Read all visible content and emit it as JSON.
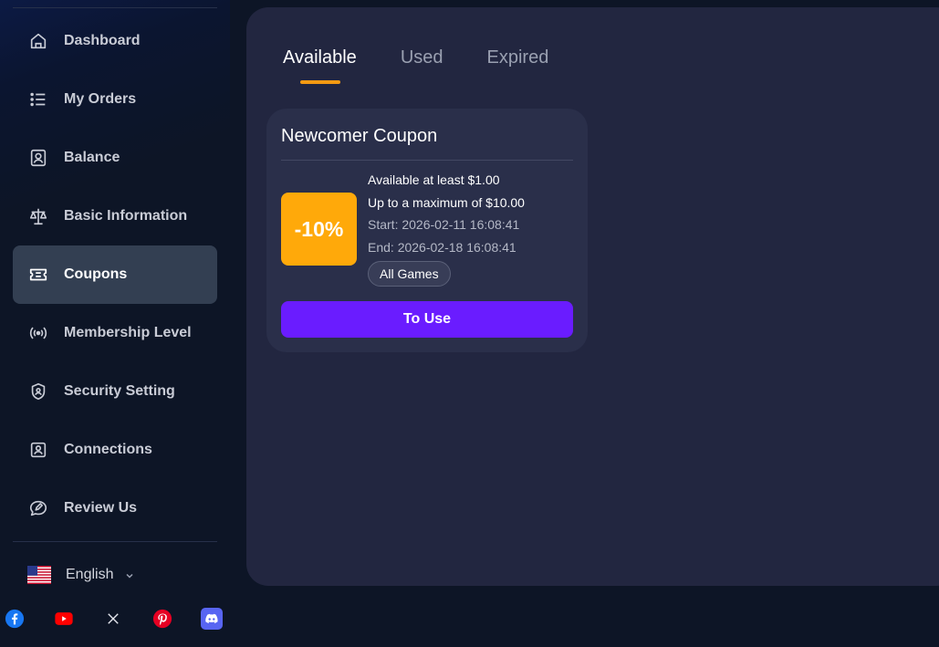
{
  "sidebar": {
    "items": [
      {
        "label": "Dashboard",
        "icon": "home-icon"
      },
      {
        "label": "My Orders",
        "icon": "list-icon"
      },
      {
        "label": "Balance",
        "icon": "balance-icon"
      },
      {
        "label": "Basic Information",
        "icon": "scales-icon"
      },
      {
        "label": "Coupons",
        "icon": "ticket-icon",
        "active": true
      },
      {
        "label": "Membership Level",
        "icon": "broadcast-icon"
      },
      {
        "label": "Security Setting",
        "icon": "shield-icon"
      },
      {
        "label": "Connections",
        "icon": "contact-icon"
      },
      {
        "label": "Review Us",
        "icon": "chat-edit-icon"
      }
    ],
    "language": {
      "label": "English",
      "icon": "us-flag-icon"
    },
    "socials": [
      "facebook-icon",
      "youtube-icon",
      "x-icon",
      "pinterest-icon",
      "discord-icon"
    ]
  },
  "main": {
    "tabs": [
      {
        "label": "Available",
        "active": true
      },
      {
        "label": "Used"
      },
      {
        "label": "Expired"
      }
    ],
    "coupon": {
      "title": "Newcomer Coupon",
      "discount": "-10%",
      "min_line": "Available at least $1.00",
      "max_line": "Up to a maximum of $10.00",
      "start": "Start: 2026-02-11 16:08:41",
      "end": "End: 2026-02-18 16:08:41",
      "scope": "All Games",
      "action": "To Use"
    }
  },
  "colors": {
    "accent_orange": "#ffa90a",
    "tab_underline": "#f59a12",
    "button_purple": "#6a1cff",
    "panel_bg": "#222640",
    "page_bg": "#0d1526"
  }
}
